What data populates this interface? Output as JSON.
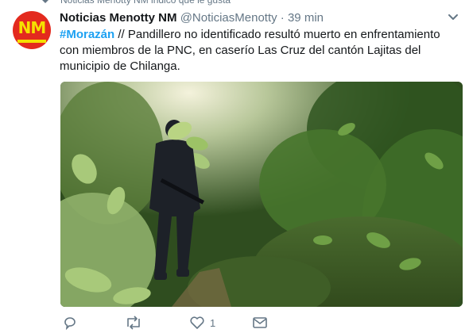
{
  "context": {
    "text": "Noticias Menotty NM indicó que le gusta"
  },
  "tweet": {
    "avatar_text": "NM",
    "author_name": "Noticias Menotty NM",
    "handle": "@NoticiasMenotty",
    "separator": "·",
    "time": "39 min",
    "hashtag": "#Morazán",
    "body": " // Pandillero no identificado resultó muerto en enfrentamiento con miembros de la PNC, en caserío Las Cruz del cantón Lajitas del municipio de Chilanga.",
    "like_count": "1"
  },
  "colors": {
    "link": "#1da1f2",
    "secondary_text": "#657786",
    "avatar_bg": "#e32a1e",
    "avatar_text": "#f5e000"
  },
  "icons": [
    "heart-icon",
    "chevron-down-icon",
    "reply-icon",
    "retweet-icon",
    "like-icon",
    "direct-message-icon"
  ]
}
